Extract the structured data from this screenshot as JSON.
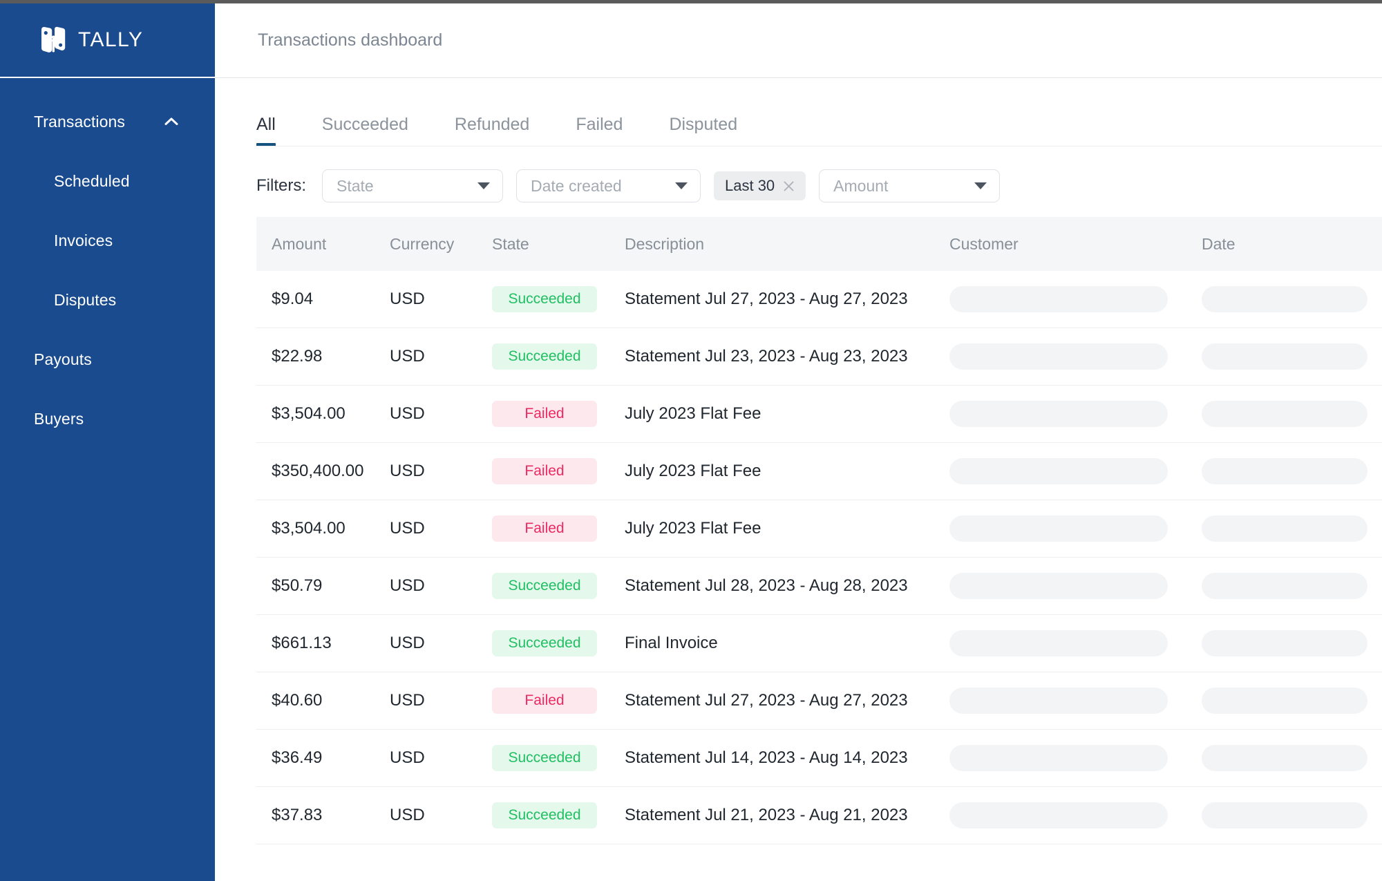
{
  "brand": {
    "name": "TALLY",
    "sidebar_color": "#1a4b8e",
    "accent_color": "#14527f"
  },
  "sidebar": {
    "items": [
      {
        "label": "Transactions",
        "level": "top",
        "expanded": true,
        "icon": "chevron-up-icon"
      },
      {
        "label": "Scheduled",
        "level": "sub"
      },
      {
        "label": "Invoices",
        "level": "sub"
      },
      {
        "label": "Disputes",
        "level": "sub"
      },
      {
        "label": "Payouts",
        "level": "top"
      },
      {
        "label": "Buyers",
        "level": "top"
      }
    ]
  },
  "header": {
    "title": "Transactions dashboard"
  },
  "tabs": {
    "active": "All",
    "items": [
      {
        "label": "All",
        "active": true
      },
      {
        "label": "Succeeded",
        "active": false
      },
      {
        "label": "Refunded",
        "active": false
      },
      {
        "label": "Failed",
        "active": false
      },
      {
        "label": "Disputed",
        "active": false
      }
    ]
  },
  "filters": {
    "label": "Filters:",
    "state": {
      "placeholder": "State",
      "value": ""
    },
    "date_created": {
      "placeholder": "Date created",
      "value": ""
    },
    "chip": {
      "label": "Last 30",
      "removable": true
    },
    "amount": {
      "placeholder": "Amount",
      "value": ""
    }
  },
  "table": {
    "columns": [
      "Amount",
      "Currency",
      "State",
      "Description",
      "Customer",
      "Date"
    ],
    "rows": [
      {
        "amount": "$9.04",
        "currency": "USD",
        "state": "Succeeded",
        "description": "Statement Jul 27, 2023 - Aug 27, 2023",
        "customer": "",
        "date": ""
      },
      {
        "amount": "$22.98",
        "currency": "USD",
        "state": "Succeeded",
        "description": "Statement Jul 23, 2023 - Aug 23, 2023",
        "customer": "",
        "date": ""
      },
      {
        "amount": "$3,504.00",
        "currency": "USD",
        "state": "Failed",
        "description": "July 2023 Flat Fee",
        "customer": "",
        "date": ""
      },
      {
        "amount": "$350,400.00",
        "currency": "USD",
        "state": "Failed",
        "description": "July 2023 Flat Fee",
        "customer": "",
        "date": ""
      },
      {
        "amount": "$3,504.00",
        "currency": "USD",
        "state": "Failed",
        "description": "July 2023 Flat Fee",
        "customer": "",
        "date": ""
      },
      {
        "amount": "$50.79",
        "currency": "USD",
        "state": "Succeeded",
        "description": "Statement Jul 28, 2023 - Aug 28, 2023",
        "customer": "",
        "date": ""
      },
      {
        "amount": "$661.13",
        "currency": "USD",
        "state": "Succeeded",
        "description": "Final Invoice",
        "customer": "",
        "date": ""
      },
      {
        "amount": "$40.60",
        "currency": "USD",
        "state": "Failed",
        "description": "Statement Jul 27, 2023 - Aug 27, 2023",
        "customer": "",
        "date": ""
      },
      {
        "amount": "$36.49",
        "currency": "USD",
        "state": "Succeeded",
        "description": "Statement Jul 14, 2023 - Aug 14, 2023",
        "customer": "",
        "date": ""
      },
      {
        "amount": "$37.83",
        "currency": "USD",
        "state": "Succeeded",
        "description": "Statement Jul 21, 2023 - Aug 21, 2023",
        "customer": "",
        "date": ""
      }
    ],
    "state_colors": {
      "Succeeded": {
        "bg": "#e4f8ec",
        "fg": "#1fbf62"
      },
      "Failed": {
        "bg": "#fde8ee",
        "fg": "#ec2a62"
      }
    }
  }
}
